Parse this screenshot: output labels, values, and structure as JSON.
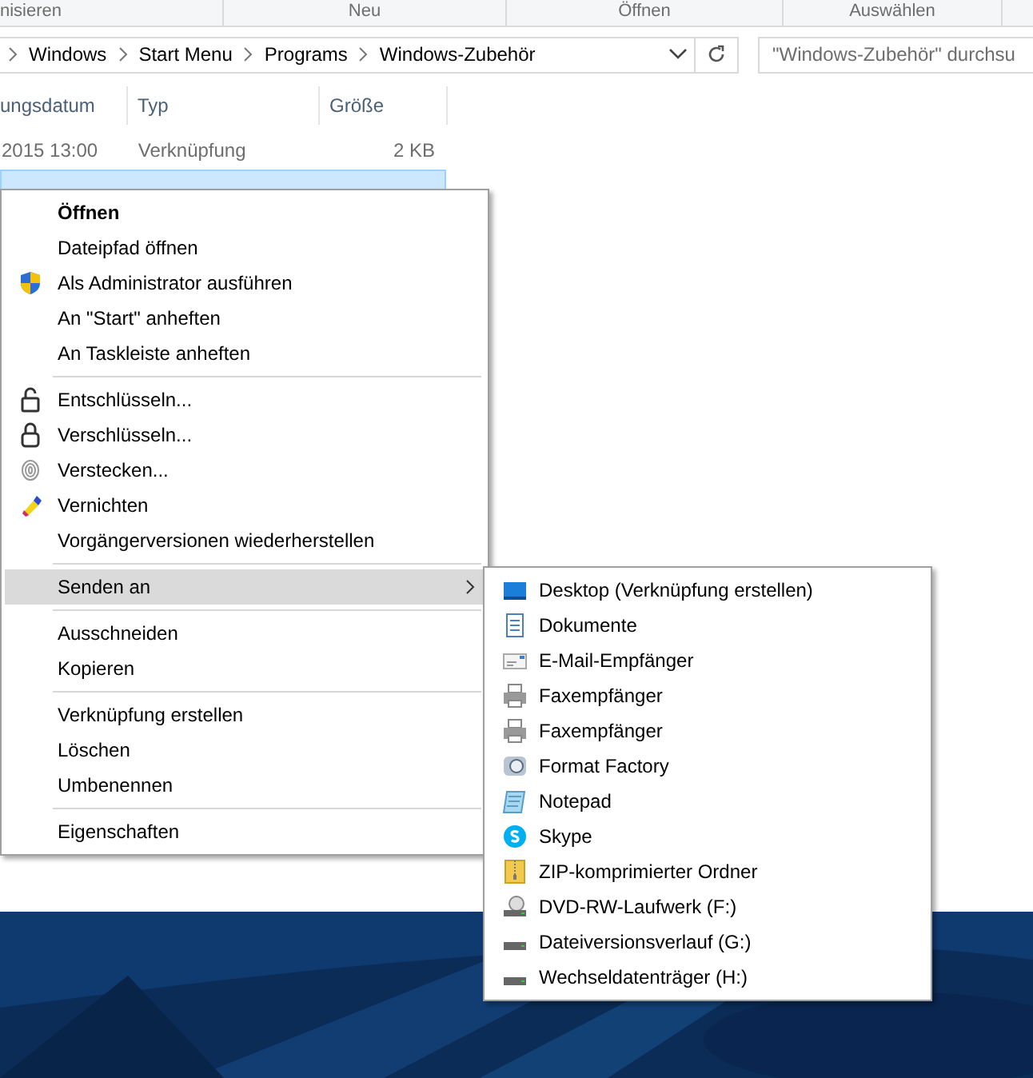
{
  "ribbon": {
    "groups": [
      "nisieren",
      "Neu",
      "Öffnen",
      "Auswählen"
    ]
  },
  "address_bar": {
    "segments": [
      "Windows",
      "Start Menu",
      "Programs",
      "Windows-Zubehör"
    ]
  },
  "search": {
    "placeholder": "\"Windows-Zubehör\" durchsu"
  },
  "file_list": {
    "columns": [
      "ungsdatum",
      "Typ",
      "Größe"
    ],
    "rows": [
      {
        "cells": [
          "2015 13:00",
          "Verknüpfung",
          "2 KB"
        ],
        "selected": false
      },
      {
        "selected": true
      }
    ]
  },
  "context_menu": {
    "groups": [
      [
        {
          "label": "Öffnen",
          "kind": "item",
          "default": true,
          "selected": false
        },
        {
          "label": "Dateipfad öffnen",
          "kind": "item",
          "default": false,
          "selected": false
        },
        {
          "label": "Als Administrator ausführen",
          "kind": "item",
          "default": false,
          "selected": false
        },
        {
          "label": "An \"Start\" anheften",
          "kind": "item",
          "default": false,
          "selected": false
        },
        {
          "label": "An Taskleiste anheften",
          "kind": "item",
          "default": false,
          "selected": false
        }
      ],
      [
        {
          "label": "Entschlüsseln...",
          "kind": "item",
          "default": false,
          "selected": false
        },
        {
          "label": "Verschlüsseln...",
          "kind": "item",
          "default": false,
          "selected": false
        },
        {
          "label": "Verstecken...",
          "kind": "item",
          "default": false,
          "selected": false
        },
        {
          "label": "Vernichten",
          "kind": "item",
          "default": false,
          "selected": false
        },
        {
          "label": "Vorgängerversionen wiederherstellen",
          "kind": "item",
          "default": false,
          "selected": false
        }
      ],
      [
        {
          "label": "Senden an",
          "kind": "submenu",
          "default": false,
          "selected": true
        }
      ],
      [
        {
          "label": "Ausschneiden",
          "kind": "item",
          "default": false,
          "selected": false
        },
        {
          "label": "Kopieren",
          "kind": "item",
          "default": false,
          "selected": false
        }
      ],
      [
        {
          "label": "Verknüpfung erstellen",
          "kind": "item",
          "default": false,
          "selected": false
        },
        {
          "label": "Löschen",
          "kind": "item",
          "default": false,
          "selected": false
        },
        {
          "label": "Umbenennen",
          "kind": "item",
          "default": false,
          "selected": false
        }
      ],
      [
        {
          "label": "Eigenschaften",
          "kind": "item",
          "default": false,
          "selected": false
        }
      ]
    ]
  },
  "send_to_menu": {
    "items": [
      {
        "label": "Desktop (Verknüpfung erstellen)"
      },
      {
        "label": "Dokumente"
      },
      {
        "label": "E-Mail-Empfänger"
      },
      {
        "label": "Faxempfänger"
      },
      {
        "label": "Faxempfänger"
      },
      {
        "label": "Format Factory"
      },
      {
        "label": "Notepad"
      },
      {
        "label": "Skype"
      },
      {
        "label": "ZIP-komprimierter Ordner"
      },
      {
        "label": "DVD-RW-Laufwerk (F:)"
      },
      {
        "label": "Dateiversionsverlauf (G:)"
      },
      {
        "label": "Wechseldatenträger (H:)"
      }
    ]
  }
}
